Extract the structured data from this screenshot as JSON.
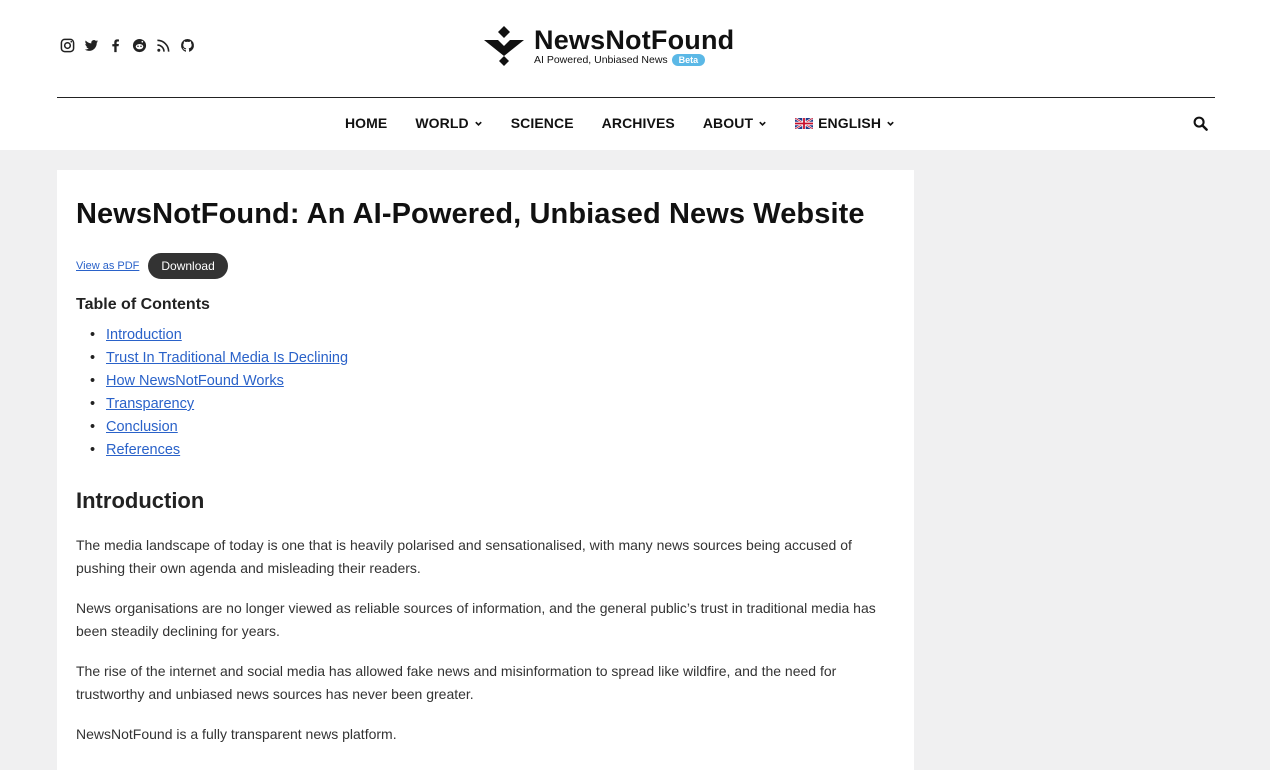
{
  "header": {
    "social_icons": [
      "instagram-icon",
      "twitter-icon",
      "facebook-icon",
      "reddit-icon",
      "rss-icon",
      "github-icon"
    ],
    "logo": {
      "title": "NewsNotFound",
      "tagline": "AI Powered, Unbiased News",
      "badge": "Beta"
    }
  },
  "nav": {
    "items": [
      {
        "label": "HOME",
        "dropdown": false
      },
      {
        "label": "WORLD",
        "dropdown": true
      },
      {
        "label": "SCIENCE",
        "dropdown": false
      },
      {
        "label": "ARCHIVES",
        "dropdown": false
      },
      {
        "label": "ABOUT",
        "dropdown": true
      },
      {
        "label": "ENGLISH",
        "dropdown": true,
        "icon": "uk-flag-icon"
      }
    ],
    "search_icon": "search-icon"
  },
  "article": {
    "title": "NewsNotFound: An AI-Powered, Unbiased News Website",
    "view_pdf": "View as PDF",
    "download": "Download",
    "toc_title": "Table of Contents",
    "toc": [
      "Introduction",
      "Trust In Traditional Media Is Declining",
      "How NewsNotFound Works",
      "Transparency",
      "Conclusion",
      "References"
    ],
    "intro_heading": "Introduction",
    "paragraphs": [
      "The media landscape of today is one that is heavily polarised and sensationalised, with many news sources being accused of pushing their own agenda and misleading their readers.",
      "News organisations are no longer viewed as reliable sources of information, and the general public’s trust in traditional media has been steadily declining for years.",
      "The rise of the internet and social media has allowed fake news and misinformation to spread like wildfire, and the need for trustworthy and unbiased news sources has never been greater.",
      "NewsNotFound is a fully transparent news platform."
    ]
  },
  "colors": {
    "link": "#2a62c9",
    "beta_badge": "#5bb8e6",
    "page_bg": "#f0f0f1",
    "button_bg": "#333333"
  }
}
